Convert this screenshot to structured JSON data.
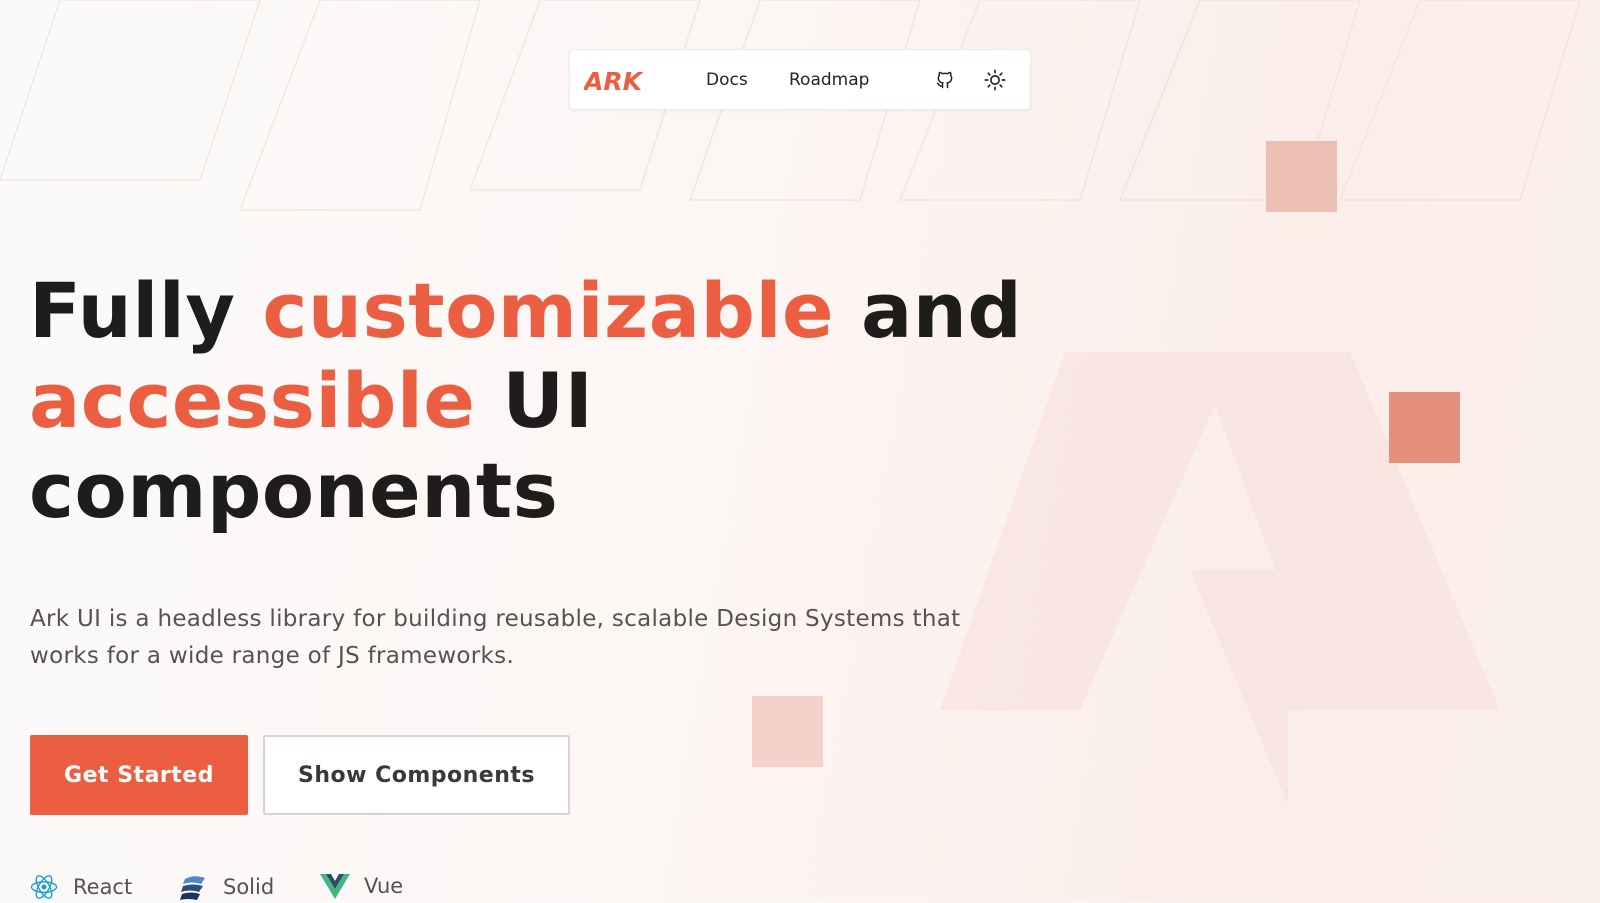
{
  "nav": {
    "logo_text": "ARK",
    "links": [
      {
        "label": "Docs"
      },
      {
        "label": "Roadmap"
      }
    ],
    "icons": [
      "github-icon",
      "sun-icon"
    ]
  },
  "hero": {
    "headline": {
      "part1": "Fully ",
      "accent1": "customizable",
      "part2": " and",
      "accent2": "accessible",
      "part3": " UI",
      "part4": "components"
    },
    "description": "Ark UI is a headless library for building reusable, scalable Design Systems that works for a wide range of JS frameworks.",
    "primary_button": "Get Started",
    "secondary_button": "Show Components"
  },
  "frameworks": [
    {
      "label": "React",
      "icon": "react-icon"
    },
    {
      "label": "Solid",
      "icon": "solid-icon"
    },
    {
      "label": "Vue",
      "icon": "vue-icon"
    }
  ],
  "colors": {
    "accent": "#eb5e41",
    "text": "#1f1d1c",
    "muted": "#57524f"
  }
}
